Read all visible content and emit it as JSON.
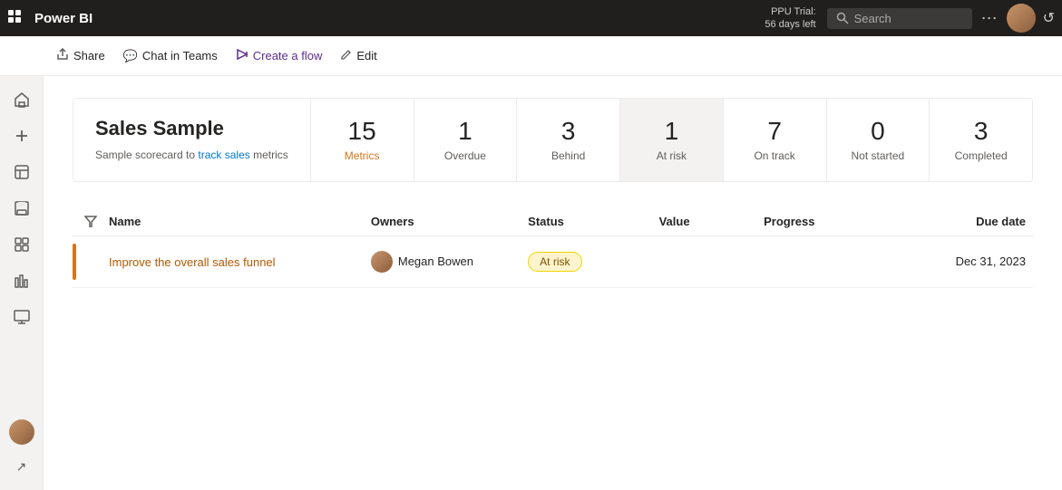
{
  "topbar": {
    "app_name": "Power BI",
    "trial_line1": "PPU Trial:",
    "trial_line2": "56 days left",
    "search_placeholder": "Search",
    "more_icon": "⋯",
    "grid_icon": "⊞"
  },
  "toolbar": {
    "share_label": "Share",
    "chat_label": "Chat in Teams",
    "create_flow_label": "Create a flow",
    "edit_label": "Edit"
  },
  "summary": {
    "title": "Sales Sample",
    "description_plain": "Sample scorecard to track sales",
    "description_link_text": "track sales",
    "description_suffix": "metrics"
  },
  "metrics": [
    {
      "number": "15",
      "label": "Metrics",
      "highlighted": false,
      "orange_label": true
    },
    {
      "number": "1",
      "label": "Overdue",
      "highlighted": false,
      "orange_label": false
    },
    {
      "number": "3",
      "label": "Behind",
      "highlighted": false,
      "orange_label": false
    },
    {
      "number": "1",
      "label": "At risk",
      "highlighted": true,
      "orange_label": false
    },
    {
      "number": "7",
      "label": "On track",
      "highlighted": false,
      "orange_label": false
    },
    {
      "number": "0",
      "label": "Not started",
      "highlighted": false,
      "orange_label": false
    },
    {
      "number": "3",
      "label": "Completed",
      "highlighted": false,
      "orange_label": false
    }
  ],
  "table": {
    "columns": {
      "name": "Name",
      "owners": "Owners",
      "status": "Status",
      "value": "Value",
      "progress": "Progress",
      "due_date": "Due date"
    },
    "rows": [
      {
        "name": "Improve the overall sales funnel",
        "owner_name": "Megan Bowen",
        "status": "At risk",
        "value": "",
        "progress": "",
        "due_date": "Dec 31, 2023",
        "indicator_color": "#d4751b"
      }
    ]
  },
  "sidebar": {
    "icons": [
      "⊞",
      "+",
      "☰",
      "💾",
      "📋",
      "⊡",
      "📊",
      "🖥"
    ]
  }
}
